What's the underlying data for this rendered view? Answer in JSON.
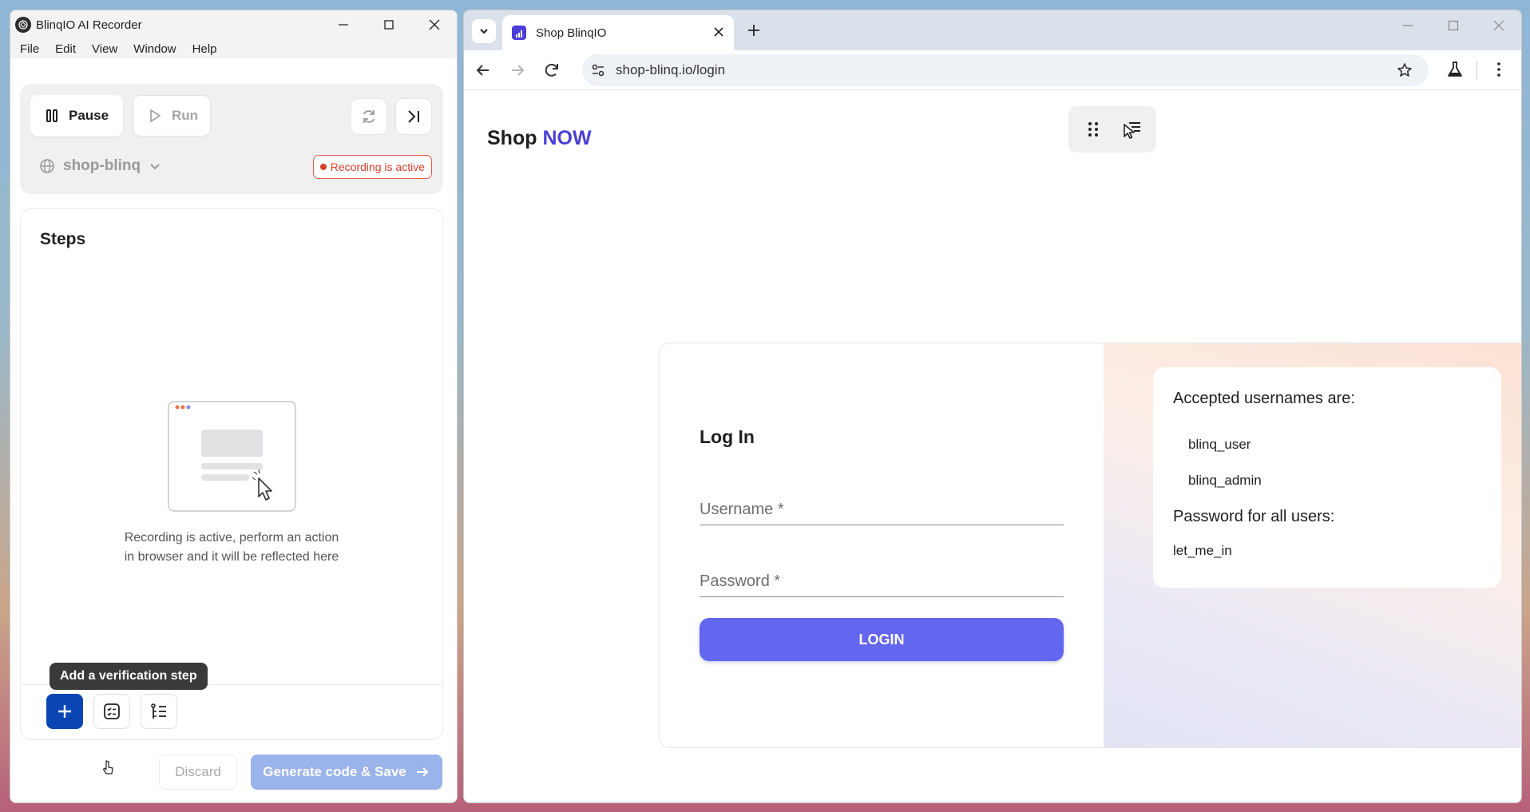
{
  "recorder": {
    "window_title": "BlinqIO AI Recorder",
    "menu": [
      "File",
      "Edit",
      "View",
      "Window",
      "Help"
    ],
    "pause_label": "Pause",
    "run_label": "Run",
    "site_name": "shop-blinq",
    "recording_badge": "Recording is active",
    "steps_title": "Steps",
    "empty_line1": "Recording is active, perform an action",
    "empty_line2": "in browser and it will be reflected here",
    "tooltip": "Add a verification step",
    "discard_label": "Discard",
    "generate_label": "Generate code & Save",
    "colors": {
      "primary": "#0a45b3",
      "recording": "#d9402c",
      "generate_disabled": "#9ab3ea"
    }
  },
  "browser": {
    "tab_title": "Shop BlinqIO",
    "url": "shop-blinq.io/login",
    "page": {
      "brand_prefix": "Shop",
      "brand_accent": "NOW",
      "login_title": "Log In",
      "username_placeholder": "Username *",
      "password_placeholder": "Password *",
      "login_button": "LOGIN",
      "accepted_heading": "Accepted usernames are:",
      "usernames": [
        "blinq_user",
        "blinq_admin"
      ],
      "password_heading": "Password for all users:",
      "password_value": "let_me_in",
      "colors": {
        "accent": "#4b3fd6",
        "button": "#6366ee"
      }
    }
  }
}
